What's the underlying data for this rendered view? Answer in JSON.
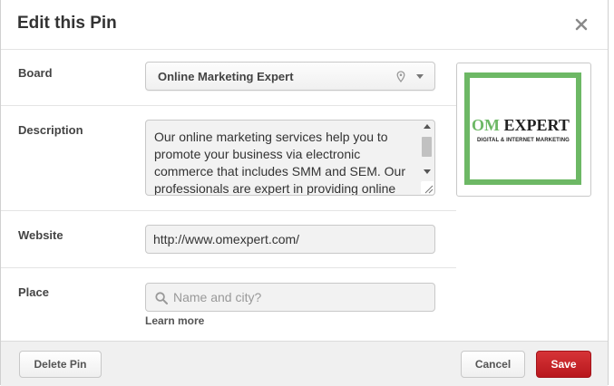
{
  "dialog": {
    "title": "Edit this Pin",
    "close_icon": "close-icon"
  },
  "form": {
    "board": {
      "label": "Board",
      "value": "Online Marketing Expert"
    },
    "description": {
      "label": "Description",
      "value": "Our online marketing services help you to promote your business via electronic commerce that includes SMM and SEM. Our professionals are expert in providing online"
    },
    "website": {
      "label": "Website",
      "value": "http://www.omexpert.com/"
    },
    "place": {
      "label": "Place",
      "placeholder": "Name and city?",
      "learn_more": "Learn more"
    }
  },
  "thumbnail": {
    "logo_om": "OM",
    "logo_expert": "EXPERT",
    "logo_tagline": "DIGITAL & INTERNET MARKETING",
    "border_color": "#6db865"
  },
  "footer": {
    "delete_label": "Delete Pin",
    "cancel_label": "Cancel",
    "save_label": "Save",
    "save_color": "#c8202a"
  }
}
